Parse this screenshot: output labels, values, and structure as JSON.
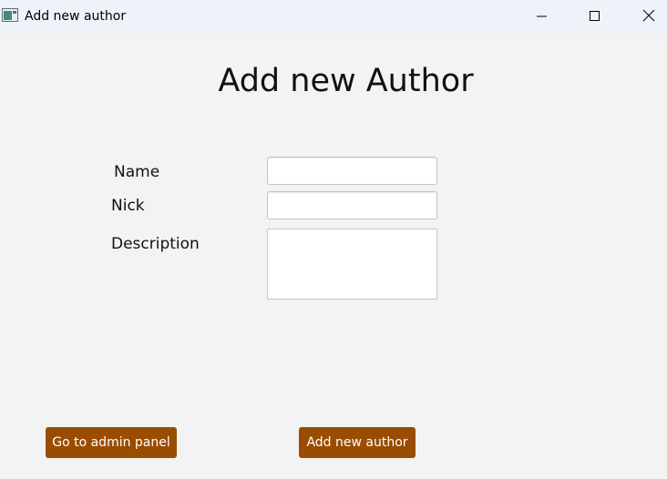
{
  "window": {
    "title": "Add new author",
    "icon": "app-window-icon",
    "controls": [
      "minimize-icon",
      "maximize-icon",
      "close-icon"
    ]
  },
  "page": {
    "heading": "Add new Author"
  },
  "form": {
    "name_label": "Name",
    "name_value": "",
    "nick_label": "Nick",
    "nick_value": "",
    "description_label": "Description",
    "description_value": ""
  },
  "buttons": {
    "admin_panel_label": "Go to admin panel",
    "add_author_label": "Add new author"
  },
  "colors": {
    "background": "#f3f3f3",
    "titlebar": "#eef2f9",
    "button_accent": "#9a4d00",
    "button_text": "#ffffff"
  }
}
